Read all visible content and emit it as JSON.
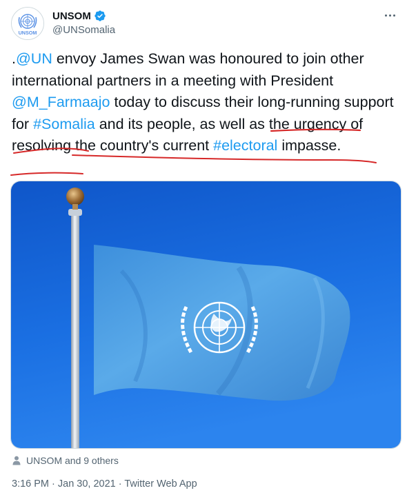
{
  "author": {
    "display_name": "UNSOM",
    "handle": "@UNSomalia",
    "avatar_label": "UNSOM",
    "avatar_icon": "un-emblem-icon",
    "verified_icon": "verified-badge-icon"
  },
  "tweet": {
    "segments": [
      {
        "text": ".",
        "type": "text"
      },
      {
        "text": "@UN",
        "type": "mention"
      },
      {
        "text": " envoy James Swan was honoured to join other international partners in a meeting with President ",
        "type": "text"
      },
      {
        "text": "@M_Farmaajo",
        "type": "mention"
      },
      {
        "text": " today to discuss their long-running support for ",
        "type": "text"
      },
      {
        "text": "#Somalia",
        "type": "hashtag"
      },
      {
        "text": " and its people, as well as the urgency of resolving the country's current ",
        "type": "text"
      },
      {
        "text": "#electoral",
        "type": "hashtag"
      },
      {
        "text": " impasse.",
        "type": "text"
      }
    ]
  },
  "media": {
    "image_icon": "un-flag-photo"
  },
  "likes": {
    "icon": "person-icon",
    "text": "UNSOM and 9 others"
  },
  "meta": {
    "timestamp": "3:16 PM · Jan 30, 2021 · Twitter Web App"
  },
  "colors": {
    "link": "#1d9bf0",
    "verified": "#1d9bf0",
    "annotation": "#d62828",
    "sky": "#1b6fe0",
    "flag": "#4a9fe0"
  }
}
